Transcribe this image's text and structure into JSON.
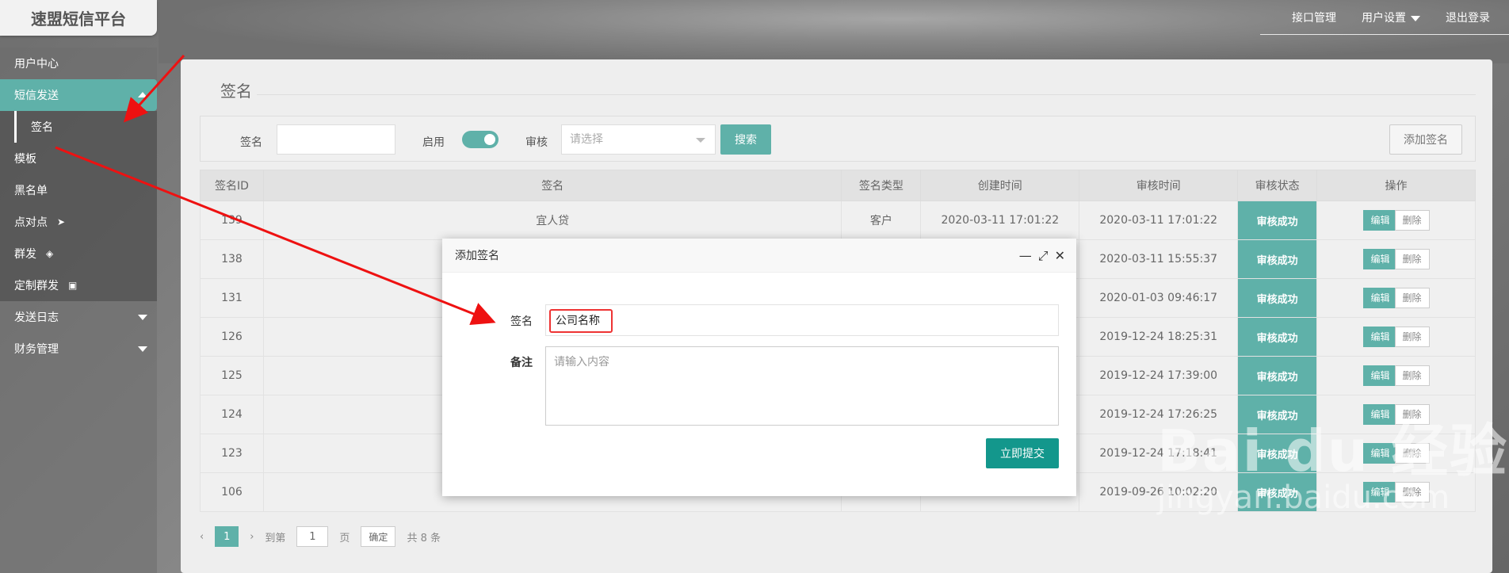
{
  "brand": "速盟短信平台",
  "topnav": {
    "api": "接口管理",
    "user_settings": "用户设置",
    "logout": "退出登录"
  },
  "sidebar": {
    "user_center": "用户中心",
    "sms_send": "短信发送",
    "sub": [
      "签名",
      "模板",
      "黑名单",
      "点对点",
      "群发",
      "定制群发"
    ],
    "send_log": "发送日志",
    "finance": "财务管理"
  },
  "page": {
    "title": "签名"
  },
  "filter": {
    "sign_label": "签名",
    "enable_label": "启用",
    "audit_label": "审核",
    "audit_placeholder": "请选择",
    "search": "搜索",
    "add": "添加签名"
  },
  "table": {
    "headers": [
      "签名ID",
      "签名",
      "签名类型",
      "创建时间",
      "审核时间",
      "审核状态",
      "操作"
    ],
    "rows": [
      {
        "id": "139",
        "name": "宜人贷",
        "type": "客户",
        "created": "2020-03-11 17:01:22",
        "audited": "2020-03-11 17:01:22",
        "status": "审核成功"
      },
      {
        "id": "138",
        "name": "",
        "type": "",
        "created": "",
        "audited": "2020-03-11 15:55:37",
        "status": "审核成功"
      },
      {
        "id": "131",
        "name": "",
        "type": "",
        "created": "",
        "audited": "2020-01-03 09:46:17",
        "status": "审核成功"
      },
      {
        "id": "126",
        "name": "",
        "type": "",
        "created": "",
        "audited": "2019-12-24 18:25:31",
        "status": "审核成功"
      },
      {
        "id": "125",
        "name": "",
        "type": "",
        "created": "",
        "audited": "2019-12-24 17:39:00",
        "status": "审核成功"
      },
      {
        "id": "124",
        "name": "",
        "type": "",
        "created": "",
        "audited": "2019-12-24 17:26:25",
        "status": "审核成功"
      },
      {
        "id": "123",
        "name": "",
        "type": "",
        "created": "",
        "audited": "2019-12-24 17:18:41",
        "status": "审核成功"
      },
      {
        "id": "106",
        "name": "",
        "type": "",
        "created": "",
        "audited": "2019-09-26 10:02:20",
        "status": "审核成功"
      }
    ],
    "edit": "编辑",
    "delete": "删除"
  },
  "pager": {
    "current": "1",
    "goto": "到第",
    "page_input": "1",
    "page_unit": "页",
    "confirm": "确定",
    "total": "共 8 条"
  },
  "modal": {
    "title": "添加签名",
    "sign_label": "签名",
    "sign_value": "公司名称",
    "remark_label": "备注",
    "remark_placeholder": "请输入内容",
    "submit": "立即提交"
  },
  "watermark": {
    "big": "Bai du 经验",
    "small": "jingyan.baidu.com"
  }
}
